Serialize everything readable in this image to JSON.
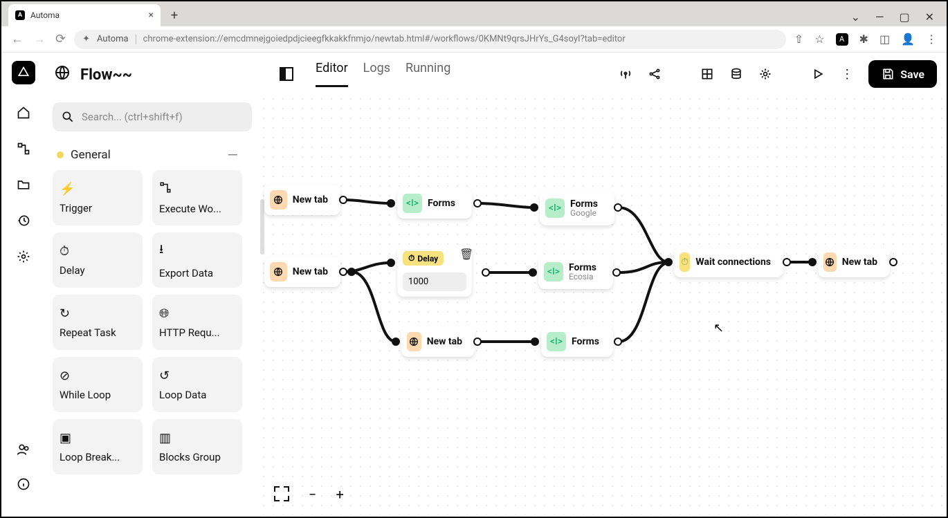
{
  "browser": {
    "tab_title": "Automa",
    "url_app": "Automa",
    "url": "chrome-extension://emcdmnejgoiedpdjcieegfkkakkfnmjo/newtab.html#/workflows/0KMNt9qrsJHrYs_G4soyI?tab=editor"
  },
  "header": {
    "flow_title": "Flow~~",
    "search_placeholder": "Search... (ctrl+shift+f)"
  },
  "tabs": [
    "Editor",
    "Logs",
    "Running"
  ],
  "save_label": "Save",
  "category": {
    "label": "General"
  },
  "blocks": [
    {
      "label": "Trigger",
      "icon": "bolt"
    },
    {
      "label": "Execute Wo...",
      "icon": "flow"
    },
    {
      "label": "Delay",
      "icon": "timer"
    },
    {
      "label": "Export Data",
      "icon": "download"
    },
    {
      "label": "Repeat Task",
      "icon": "repeat"
    },
    {
      "label": "HTTP Requ...",
      "icon": "globe"
    },
    {
      "label": "While Loop",
      "icon": "no"
    },
    {
      "label": "Loop Data",
      "icon": "loop"
    },
    {
      "label": "Loop Break...",
      "icon": "square"
    },
    {
      "label": "Blocks Group",
      "icon": "folder"
    }
  ],
  "nodes": {
    "newtab1": {
      "label": "New tab"
    },
    "forms1": {
      "label": "Forms"
    },
    "forms_google": {
      "label": "Forms",
      "sub": "Google"
    },
    "newtab2": {
      "label": "New tab"
    },
    "delay": {
      "label": "Delay",
      "value": "1000"
    },
    "forms_ecosia": {
      "label": "Forms",
      "sub": "Ecosia"
    },
    "newtab3": {
      "label": "New tab"
    },
    "forms3": {
      "label": "Forms"
    },
    "wait": {
      "label": "Wait connections"
    },
    "newtab4": {
      "label": "New tab"
    }
  },
  "icons": {
    "globe": "🌐",
    "code": "</>",
    "timer": "⏱",
    "trash": "🗑"
  }
}
